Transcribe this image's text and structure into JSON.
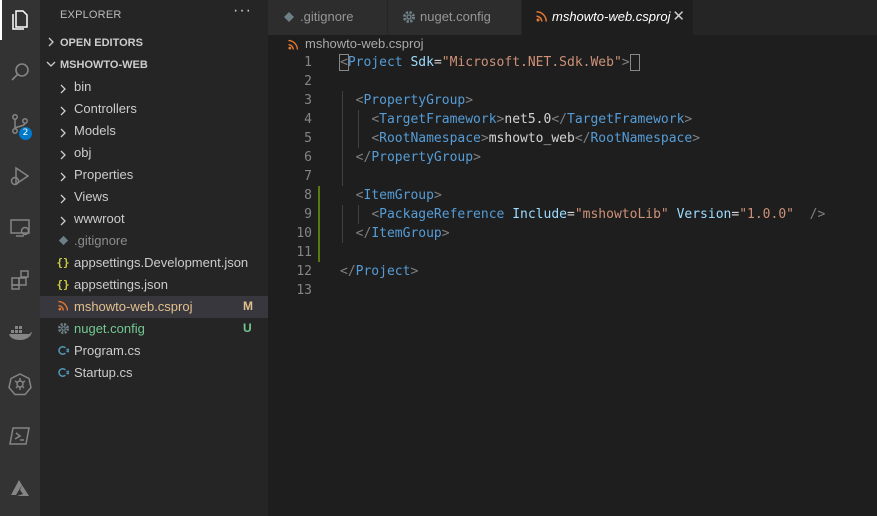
{
  "colors": {
    "accent": "#007acc",
    "modified": "#e2c08d",
    "untracked": "#73c991",
    "rss_orange": "#e37933",
    "json_yellow": "#cbcb41",
    "gear": "#6d8086",
    "cs_blue": "#519aba"
  },
  "activity_bar": {
    "items": [
      "files-icon",
      "search-icon",
      "source-control-icon",
      "run-debug-icon",
      "remote-explorer-icon",
      "extensions-icon",
      "docker-icon",
      "kubernetes-icon",
      "terminal-icon",
      "azure-icon"
    ],
    "source_control_badge": "2"
  },
  "explorer": {
    "title": "EXPLORER",
    "more_label": "···",
    "open_editors_label": "OPEN EDITORS",
    "project_label": "MSHOWTO-WEB",
    "tree": [
      {
        "name": "bin",
        "type": "folder"
      },
      {
        "name": "Controllers",
        "type": "folder"
      },
      {
        "name": "Models",
        "type": "folder"
      },
      {
        "name": "obj",
        "type": "folder"
      },
      {
        "name": "Properties",
        "type": "folder"
      },
      {
        "name": "Views",
        "type": "folder"
      },
      {
        "name": "wwwroot",
        "type": "folder"
      },
      {
        "name": ".gitignore",
        "type": "gitignore-icon"
      },
      {
        "name": "appsettings.Development.json",
        "type": "json-icon"
      },
      {
        "name": "appsettings.json",
        "type": "json-icon"
      },
      {
        "name": "mshowto-web.csproj",
        "type": "rss-icon",
        "status": "M"
      },
      {
        "name": "nuget.config",
        "type": "gear-icon",
        "status": "U"
      },
      {
        "name": "Program.cs",
        "type": "csharp-icon"
      },
      {
        "name": "Startup.cs",
        "type": "csharp-icon"
      }
    ]
  },
  "tabs": [
    {
      "label": ".gitignore",
      "icon": "gitignore-icon"
    },
    {
      "label": "nuget.config",
      "icon": "gear-icon"
    },
    {
      "label": "mshowto-web.csproj",
      "icon": "rss-icon",
      "close": "✕"
    }
  ],
  "breadcrumb": {
    "file": "mshowto-web.csproj"
  },
  "code_lines": [
    {
      "n": "1",
      "tokens": [
        [
          "br",
          "<"
        ],
        [
          "tag",
          "Project"
        ],
        [
          "txt",
          " "
        ],
        [
          "attr",
          "Sdk"
        ],
        [
          "txt",
          "="
        ],
        [
          "str",
          "\"Microsoft.NET.Sdk.Web\""
        ],
        [
          "br",
          ">"
        ]
      ]
    },
    {
      "n": "2",
      "tokens": []
    },
    {
      "n": "3",
      "tokens": [
        [
          "txt",
          "  "
        ],
        [
          "br",
          "<"
        ],
        [
          "tag",
          "PropertyGroup"
        ],
        [
          "br",
          ">"
        ]
      ]
    },
    {
      "n": "4",
      "tokens": [
        [
          "txt",
          "    "
        ],
        [
          "br",
          "<"
        ],
        [
          "tag",
          "TargetFramework"
        ],
        [
          "br",
          ">"
        ],
        [
          "txt",
          "net5.0"
        ],
        [
          "br",
          "</"
        ],
        [
          "tag",
          "TargetFramework"
        ],
        [
          "br",
          ">"
        ]
      ]
    },
    {
      "n": "5",
      "tokens": [
        [
          "txt",
          "    "
        ],
        [
          "br",
          "<"
        ],
        [
          "tag",
          "RootNamespace"
        ],
        [
          "br",
          ">"
        ],
        [
          "txt",
          "mshowto_web"
        ],
        [
          "br",
          "</"
        ],
        [
          "tag",
          "RootNamespace"
        ],
        [
          "br",
          ">"
        ]
      ]
    },
    {
      "n": "6",
      "tokens": [
        [
          "txt",
          "  "
        ],
        [
          "br",
          "</"
        ],
        [
          "tag",
          "PropertyGroup"
        ],
        [
          "br",
          ">"
        ]
      ]
    },
    {
      "n": "7",
      "tokens": []
    },
    {
      "n": "8",
      "tokens": [
        [
          "txt",
          "  "
        ],
        [
          "br",
          "<"
        ],
        [
          "tag",
          "ItemGroup"
        ],
        [
          "br",
          ">"
        ]
      ]
    },
    {
      "n": "9",
      "tokens": [
        [
          "txt",
          "    "
        ],
        [
          "br",
          "<"
        ],
        [
          "tag",
          "PackageReference"
        ],
        [
          "txt",
          " "
        ],
        [
          "attr",
          "Include"
        ],
        [
          "txt",
          "="
        ],
        [
          "str",
          "\"mshowtoLib\""
        ],
        [
          "txt",
          " "
        ],
        [
          "attr",
          "Version"
        ],
        [
          "txt",
          "="
        ],
        [
          "str",
          "\"1.0.0\""
        ],
        [
          "txt",
          "  "
        ],
        [
          "br",
          "/>"
        ]
      ]
    },
    {
      "n": "10",
      "tokens": [
        [
          "txt",
          "  "
        ],
        [
          "br",
          "</"
        ],
        [
          "tag",
          "ItemGroup"
        ],
        [
          "br",
          ">"
        ]
      ]
    },
    {
      "n": "11",
      "tokens": []
    },
    {
      "n": "12",
      "tokens": [
        [
          "br",
          "</"
        ],
        [
          "tag",
          "Project"
        ],
        [
          "br",
          ">"
        ]
      ]
    },
    {
      "n": "13",
      "tokens": []
    }
  ]
}
